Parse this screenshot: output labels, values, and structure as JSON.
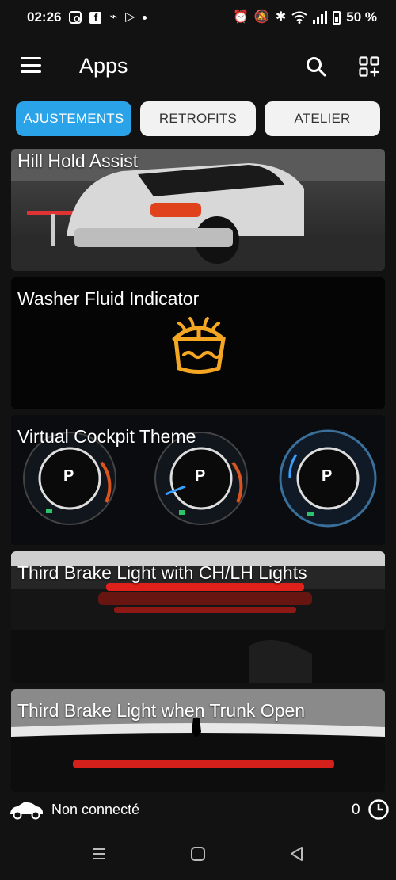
{
  "status_bar": {
    "time": "02:26",
    "battery_text": "50 %"
  },
  "app_bar": {
    "title": "Apps"
  },
  "tabs": [
    {
      "label": "AJUSTEMENTS",
      "active": true
    },
    {
      "label": "RETROFITS",
      "active": false
    },
    {
      "label": "ATELIER",
      "active": false
    }
  ],
  "cards": [
    {
      "title": "Hill Hold Assist"
    },
    {
      "title": "Washer Fluid Indicator"
    },
    {
      "title": "Virtual Cockpit Theme",
      "gauge_label": "P"
    },
    {
      "title": "Third Brake Light with CH/LH Lights"
    },
    {
      "title": "Third Brake Light when Trunk Open"
    }
  ],
  "connection": {
    "status": "Non connecté",
    "count": "0"
  },
  "colors": {
    "accent": "#2aa3e8",
    "washer_icon": "#f5a623",
    "brake_light": "#e0201a"
  }
}
